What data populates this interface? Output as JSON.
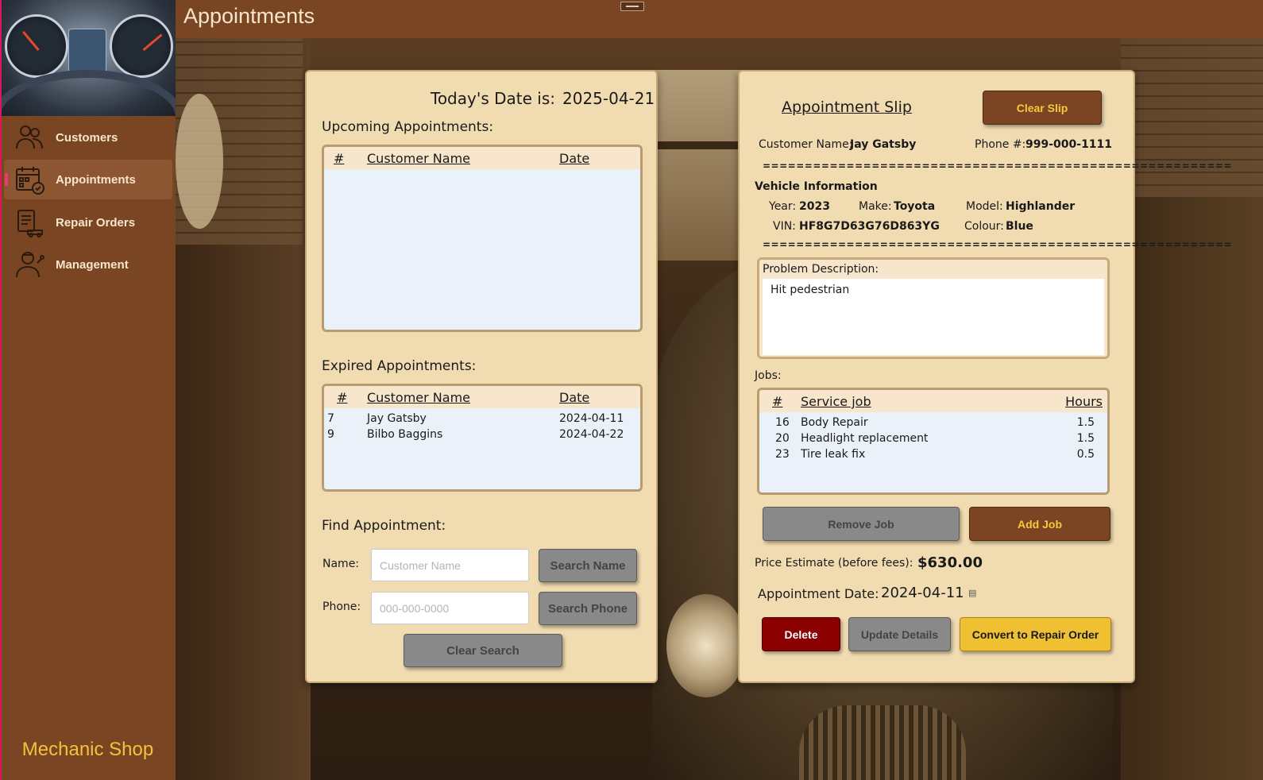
{
  "sidebar": {
    "items": [
      {
        "label": "Customers",
        "icon": "customers-icon"
      },
      {
        "label": "Appointments",
        "icon": "appointments-calendar-icon",
        "active": true
      },
      {
        "label": "Repair Orders",
        "icon": "repair-orders-icon"
      },
      {
        "label": "Management",
        "icon": "management-icon"
      }
    ],
    "brand": "Mechanic Shop"
  },
  "header": {
    "title": "Appointments"
  },
  "left_panel": {
    "today_label": "Today's Date is:",
    "today_value": "2025-04-21",
    "upcoming_title": "Upcoming Appointments:",
    "expired_title": "Expired Appointments:",
    "columns": [
      "#",
      "Customer Name",
      "Date"
    ],
    "upcoming_rows": [],
    "expired_rows": [
      {
        "id": "7",
        "name": "Jay Gatsby",
        "date": "2024-04-11"
      },
      {
        "id": "9",
        "name": "Bilbo Baggins",
        "date": "2024-04-22"
      }
    ],
    "find_title": "Find Appointment:",
    "name_label": "Name:",
    "name_placeholder": "Customer Name",
    "phone_label": "Phone:",
    "phone_placeholder": "000-000-0000",
    "search_name_button": "Search Name",
    "search_phone_button": "Search Phone",
    "clear_search_button": "Clear Search"
  },
  "slip": {
    "title": "Appointment Slip",
    "clear_button": "Clear Slip",
    "customer_name_label": "Customer Name:",
    "customer_name": "Jay Gatsby",
    "phone_label": "Phone #:",
    "phone": "999-000-1111",
    "separator": "========================================================",
    "vehicle_title": "Vehicle Information",
    "year_label": "Year:",
    "year": "2023",
    "make_label": "Make:",
    "make": "Toyota",
    "model_label": "Model:",
    "model": "Highlander",
    "vin_label": "VIN:",
    "vin": "HF8G7D63G76D863YG",
    "colour_label": "Colour:",
    "colour": "Blue",
    "problem_label": "Problem Description:",
    "problem": "Hit pedestrian",
    "jobs_label": "Jobs:",
    "job_columns": [
      "#",
      "Service job",
      "Hours"
    ],
    "jobs": [
      {
        "id": "16",
        "name": "Body Repair",
        "hours": "1.5"
      },
      {
        "id": "20",
        "name": "Headlight replacement",
        "hours": "1.5"
      },
      {
        "id": "23",
        "name": "Tire leak fix",
        "hours": "0.5"
      }
    ],
    "remove_job_button": "Remove Job",
    "add_job_button": "Add Job",
    "price_label": "Price Estimate (before fees):",
    "price": "$630.00",
    "date_label": "Appointment Date:",
    "date": "2024-04-11",
    "delete_button": "Delete",
    "update_button": "Update Details",
    "convert_button": "Convert to Repair Order"
  },
  "colors": {
    "sidebar_bg": "#7a4522",
    "panel_bg": "#f1dcb1",
    "accent_yellow": "#efc032",
    "delete_red": "#8b0000",
    "brand_gold": "#f2c33a"
  }
}
